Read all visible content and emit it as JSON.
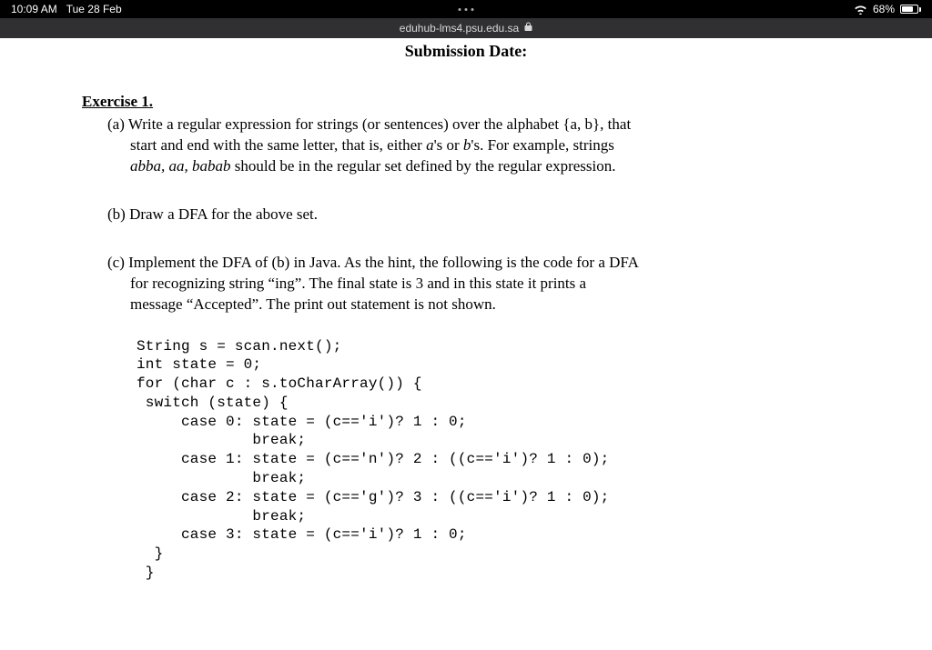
{
  "status": {
    "time": "10:09 AM",
    "date": "Tue 28 Feb",
    "battery_pct": "68%"
  },
  "browser": {
    "url": "eduhub-lms4.psu.edu.sa"
  },
  "doc": {
    "submission_label": "Submission Date:",
    "exercise_title": "Exercise 1.",
    "part_a": {
      "label": "(a)",
      "line1": "Write a regular expression for strings (or sentences) over the alphabet {a, b}, that",
      "line2_plain1": "start and end with the same letter, that is, either ",
      "line2_em1": "a",
      "line2_plain2": "'s or ",
      "line2_em2": "b",
      "line2_plain3": "'s. For example, strings",
      "line3_em": "abba, aa, babab",
      "line3_plain": " should be in the regular set defined by the regular expression."
    },
    "part_b": {
      "label": "(b)",
      "text": "Draw a DFA for the above set."
    },
    "part_c": {
      "label": "(c)",
      "line1": "Implement the DFA of (b) in Java. As the hint, the following is the code for a DFA",
      "line2": "for recognizing string “ing”. The final state is 3 and in this state it prints a",
      "line3": "message “Accepted”. The print out statement is not shown."
    },
    "code": "String s = scan.next();\nint state = 0;\nfor (char c : s.toCharArray()) {\n switch (state) {\n     case 0: state = (c=='i')? 1 : 0;\n             break;\n     case 1: state = (c=='n')? 2 : ((c=='i')? 1 : 0);\n             break;\n     case 2: state = (c=='g')? 3 : ((c=='i')? 1 : 0);\n             break;\n     case 3: state = (c=='i')? 1 : 0;\n  }\n }"
  }
}
